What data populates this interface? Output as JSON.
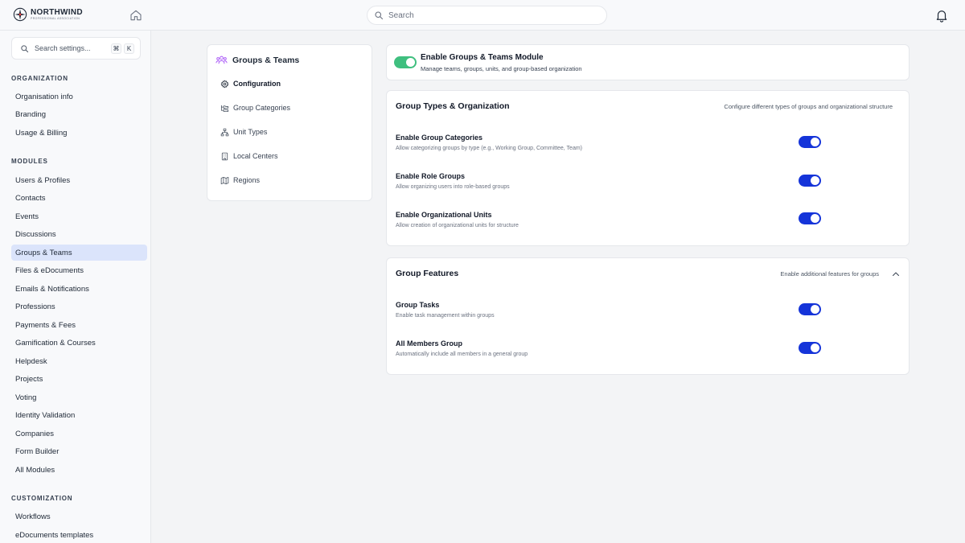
{
  "brand": {
    "name": "NORTHWIND",
    "tagline": "PROFESSIONAL ASSOCIATION"
  },
  "header": {
    "search_placeholder": "Search"
  },
  "sidebar": {
    "search_placeholder": "Search settings...",
    "shortcut_keys": [
      "⌘",
      "K"
    ],
    "sections": [
      {
        "label": "ORGANIZATION",
        "items": [
          {
            "label": "Organisation info"
          },
          {
            "label": "Branding"
          },
          {
            "label": "Usage & Billing"
          }
        ]
      },
      {
        "label": "MODULES",
        "items": [
          {
            "label": "Users & Profiles"
          },
          {
            "label": "Contacts"
          },
          {
            "label": "Events"
          },
          {
            "label": "Discussions"
          },
          {
            "label": "Groups & Teams",
            "active": true
          },
          {
            "label": "Files & eDocuments"
          },
          {
            "label": "Emails & Notifications"
          },
          {
            "label": "Professions"
          },
          {
            "label": "Payments & Fees"
          },
          {
            "label": "Gamification & Courses"
          },
          {
            "label": "Helpdesk"
          },
          {
            "label": "Projects"
          },
          {
            "label": "Voting"
          },
          {
            "label": "Identity Validation"
          },
          {
            "label": "Companies"
          },
          {
            "label": "Form Builder"
          },
          {
            "label": "All Modules"
          }
        ]
      },
      {
        "label": "CUSTOMIZATION",
        "items": [
          {
            "label": "Workflows"
          },
          {
            "label": "eDocuments templates"
          }
        ]
      }
    ]
  },
  "subnav": {
    "title": "Groups & Teams",
    "items": [
      {
        "label": "Configuration",
        "icon": "gear-icon",
        "active": true
      },
      {
        "label": "Group Categories",
        "icon": "folder-tree-icon"
      },
      {
        "label": "Unit Types",
        "icon": "hierarchy-icon"
      },
      {
        "label": "Local Centers",
        "icon": "building-icon"
      },
      {
        "label": "Regions",
        "icon": "map-icon"
      }
    ]
  },
  "module": {
    "title": "Enable Groups & Teams Module",
    "description": "Manage teams, groups, units, and group-based organization",
    "enabled": true
  },
  "group_types": {
    "title": "Group Types & Organization",
    "description": "Configure different types of groups and organizational structure",
    "settings": [
      {
        "title": "Enable Group Categories",
        "description": "Allow categorizing groups by type (e.g., Working Group, Committee, Team)",
        "enabled": true
      },
      {
        "title": "Enable Role Groups",
        "description": "Allow organizing users into role-based groups",
        "enabled": true
      },
      {
        "title": "Enable Organizational Units",
        "description": "Allow creation of organizational units for structure",
        "enabled": true
      }
    ]
  },
  "group_features": {
    "title": "Group Features",
    "description": "Enable additional features for groups",
    "settings": [
      {
        "title": "Group Tasks",
        "description": "Enable task management within groups",
        "enabled": true
      },
      {
        "title": "All Members Group",
        "description": "Automatically include all members in a general group",
        "enabled": true
      }
    ]
  },
  "colors": {
    "toggle_on": "#1534d9",
    "module_toggle_on": "#3fbf7f",
    "active_nav_bg": "#dbe4fb",
    "icon_accent": "#a855f7"
  }
}
